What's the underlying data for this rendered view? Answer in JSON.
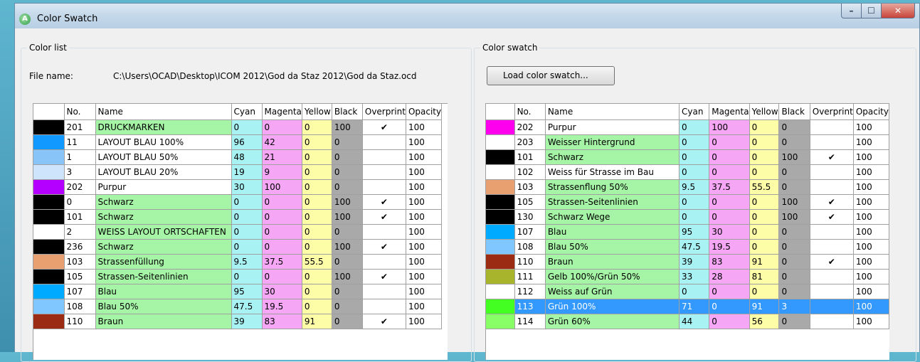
{
  "window": {
    "title": "Color Swatch",
    "app_icon": "A",
    "controls": {
      "minimize": "–",
      "maximize": "☐",
      "close": "✕"
    }
  },
  "color_list": {
    "label": "Color list",
    "file_name_label": "File name:",
    "file_path": "C:\\Users\\OCAD\\Desktop\\ICOM 2012\\God da Staz 2012\\God da Staz.ocd",
    "columns": [
      "",
      "No.",
      "Name",
      "Cyan",
      "Magenta",
      "Yellow",
      "Black",
      "Overprint",
      "Opacity"
    ],
    "rows": [
      {
        "color": "#000000",
        "no": "201",
        "name": "DRUCKMARKEN",
        "c": "0",
        "m": "0",
        "y": "0",
        "k": "100",
        "op": "✔",
        "opacity": "100",
        "name_bg": "cN"
      },
      {
        "color": "#1199ff",
        "no": "11",
        "name": "LAYOUT BLAU 100%",
        "c": "96",
        "m": "42",
        "y": "0",
        "k": "0",
        "op": "",
        "opacity": "100",
        "name_bg": "cW"
      },
      {
        "color": "#88c4f8",
        "no": "1",
        "name": "LAYOUT BLAU 50%",
        "c": "48",
        "m": "21",
        "y": "0",
        "k": "0",
        "op": "",
        "opacity": "100",
        "name_bg": "cW"
      },
      {
        "color": "#cde4fc",
        "no": "3",
        "name": "LAYOUT BLAU 20%",
        "c": "19",
        "m": "9",
        "y": "0",
        "k": "0",
        "op": "",
        "opacity": "100",
        "name_bg": "cW"
      },
      {
        "color": "#b300ff",
        "no": "202",
        "name": "Purpur",
        "c": "30",
        "m": "100",
        "y": "0",
        "k": "0",
        "op": "",
        "opacity": "100",
        "name_bg": "cW"
      },
      {
        "color": "#000000",
        "no": "0",
        "name": "Schwarz",
        "c": "0",
        "m": "0",
        "y": "0",
        "k": "100",
        "op": "✔",
        "opacity": "100",
        "name_bg": "cN"
      },
      {
        "color": "#000000",
        "no": "101",
        "name": "Schwarz",
        "c": "0",
        "m": "0",
        "y": "0",
        "k": "100",
        "op": "✔",
        "opacity": "100",
        "name_bg": "cN"
      },
      {
        "color": "#ffffff",
        "no": "2",
        "name": "WEISS LAYOUT ORTSCHAFTEN",
        "c": "0",
        "m": "0",
        "y": "0",
        "k": "0",
        "op": "",
        "opacity": "100",
        "name_bg": "cN"
      },
      {
        "color": "#000000",
        "no": "236",
        "name": "Schwarz",
        "c": "0",
        "m": "0",
        "y": "0",
        "k": "100",
        "op": "✔",
        "opacity": "100",
        "name_bg": "cN"
      },
      {
        "color": "#e8a070",
        "no": "103",
        "name": "Strassenfüllung",
        "c": "9.5",
        "m": "37.5",
        "y": "55.5",
        "k": "0",
        "op": "",
        "opacity": "100",
        "name_bg": "cN"
      },
      {
        "color": "#000000",
        "no": "105",
        "name": "Strassen-Seitenlinien",
        "c": "0",
        "m": "0",
        "y": "0",
        "k": "100",
        "op": "✔",
        "opacity": "100",
        "name_bg": "cN"
      },
      {
        "color": "#00aaff",
        "no": "107",
        "name": "Blau",
        "c": "95",
        "m": "30",
        "y": "0",
        "k": "0",
        "op": "",
        "opacity": "100",
        "name_bg": "cN"
      },
      {
        "color": "#80c6ff",
        "no": "108",
        "name": "Blau 50%",
        "c": "47.5",
        "m": "19.5",
        "y": "0",
        "k": "0",
        "op": "",
        "opacity": "100",
        "name_bg": "cN"
      },
      {
        "color": "#9c2b14",
        "no": "110",
        "name": "Braun",
        "c": "39",
        "m": "83",
        "y": "91",
        "k": "0",
        "op": "✔",
        "opacity": "100",
        "name_bg": "cN"
      }
    ]
  },
  "color_swatch": {
    "label": "Color swatch",
    "load_button": "Load color swatch...",
    "columns": [
      "",
      "No.",
      "Name",
      "Cyan",
      "Magenta",
      "Yellow",
      "Black",
      "Overprint",
      "Opacity"
    ],
    "selected_index": 12,
    "rows": [
      {
        "color": "#ff00ee",
        "no": "202",
        "name": "Purpur",
        "c": "0",
        "m": "100",
        "y": "0",
        "k": "0",
        "op": "",
        "opacity": "100",
        "name_bg": "cW"
      },
      {
        "color": "#ffffff",
        "no": "203",
        "name": "Weisser Hintergrund",
        "c": "0",
        "m": "0",
        "y": "0",
        "k": "0",
        "op": "",
        "opacity": "100",
        "name_bg": "cN"
      },
      {
        "color": "#000000",
        "no": "101",
        "name": "Schwarz",
        "c": "0",
        "m": "0",
        "y": "0",
        "k": "100",
        "op": "✔",
        "opacity": "100",
        "name_bg": "cN"
      },
      {
        "color": "#ffffff",
        "no": "102",
        "name": "Weiss für Strasse im Bau",
        "c": "0",
        "m": "0",
        "y": "0",
        "k": "0",
        "op": "",
        "opacity": "100",
        "name_bg": "cW"
      },
      {
        "color": "#e8a070",
        "no": "103",
        "name": "Strassenflung 50%",
        "c": "9.5",
        "m": "37.5",
        "y": "55.5",
        "k": "0",
        "op": "",
        "opacity": "100",
        "name_bg": "cN"
      },
      {
        "color": "#000000",
        "no": "105",
        "name": "Strassen-Seitenlinien",
        "c": "0",
        "m": "0",
        "y": "0",
        "k": "100",
        "op": "✔",
        "opacity": "100",
        "name_bg": "cN"
      },
      {
        "color": "#000000",
        "no": "130",
        "name": "Schwarz Wege",
        "c": "0",
        "m": "0",
        "y": "0",
        "k": "100",
        "op": "✔",
        "opacity": "100",
        "name_bg": "cN"
      },
      {
        "color": "#00aaff",
        "no": "107",
        "name": "Blau",
        "c": "95",
        "m": "30",
        "y": "0",
        "k": "0",
        "op": "",
        "opacity": "100",
        "name_bg": "cN"
      },
      {
        "color": "#80c6ff",
        "no": "108",
        "name": "Blau 50%",
        "c": "47.5",
        "m": "19.5",
        "y": "0",
        "k": "0",
        "op": "",
        "opacity": "100",
        "name_bg": "cN"
      },
      {
        "color": "#9c2b14",
        "no": "110",
        "name": "Braun",
        "c": "39",
        "m": "83",
        "y": "91",
        "k": "0",
        "op": "✔",
        "opacity": "100",
        "name_bg": "cN"
      },
      {
        "color": "#a8b42c",
        "no": "111",
        "name": "Gelb 100%/Grün 50%",
        "c": "33",
        "m": "28",
        "y": "81",
        "k": "0",
        "op": "",
        "opacity": "100",
        "name_bg": "cN"
      },
      {
        "color": "#ffffff",
        "no": "112",
        "name": "Weiss auf Grün",
        "c": "0",
        "m": "0",
        "y": "0",
        "k": "0",
        "op": "",
        "opacity": "100",
        "name_bg": "cN"
      },
      {
        "color": "#44ff22",
        "no": "113",
        "name": "Grün 100%",
        "c": "71",
        "m": "0",
        "y": "91",
        "k": "3",
        "op": "",
        "opacity": "100",
        "name_bg": "cN"
      },
      {
        "color": "#88ff66",
        "no": "114",
        "name": "Grün 60%",
        "c": "44",
        "m": "0",
        "y": "56",
        "k": "0",
        "op": "",
        "opacity": "100",
        "name_bg": "cN"
      }
    ]
  }
}
